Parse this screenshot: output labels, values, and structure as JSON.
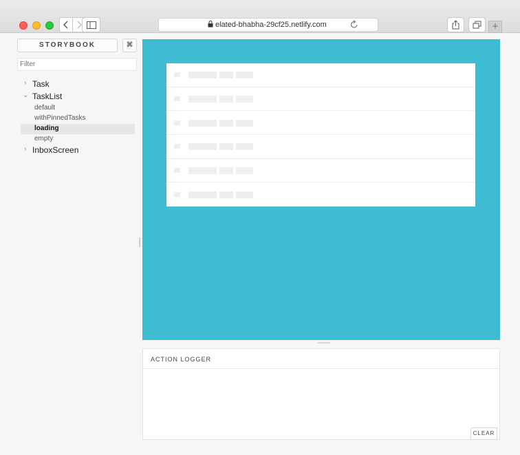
{
  "browser": {
    "url": "elated-bhabha-29cf25.netlify.com",
    "back_icon": "chevron-left-icon",
    "forward_icon": "chevron-right-icon",
    "sidebar_toggle_icon": "sidebar-icon",
    "reload_icon": "reload-icon",
    "share_icon": "share-icon",
    "tabs_icon": "tabs-icon",
    "new_tab_label": "+",
    "colors": {
      "close": "#fe5f57",
      "minimize": "#febb2e",
      "zoom": "#28c840"
    }
  },
  "sidebar": {
    "title": "STORYBOOK",
    "shortcut_label": "⌘",
    "filter_placeholder": "Filter",
    "tree": [
      {
        "label": "Task",
        "expanded": false
      },
      {
        "label": "TaskList",
        "expanded": true,
        "stories": [
          "default",
          "withPinnedTasks",
          "loading",
          "empty"
        ],
        "selected": "loading"
      },
      {
        "label": "InboxScreen",
        "expanded": false
      }
    ]
  },
  "preview": {
    "background": "#3ebdd2",
    "loading_rows": 6
  },
  "addons": {
    "panel_title": "ACTION LOGGER",
    "clear_label": "CLEAR"
  }
}
